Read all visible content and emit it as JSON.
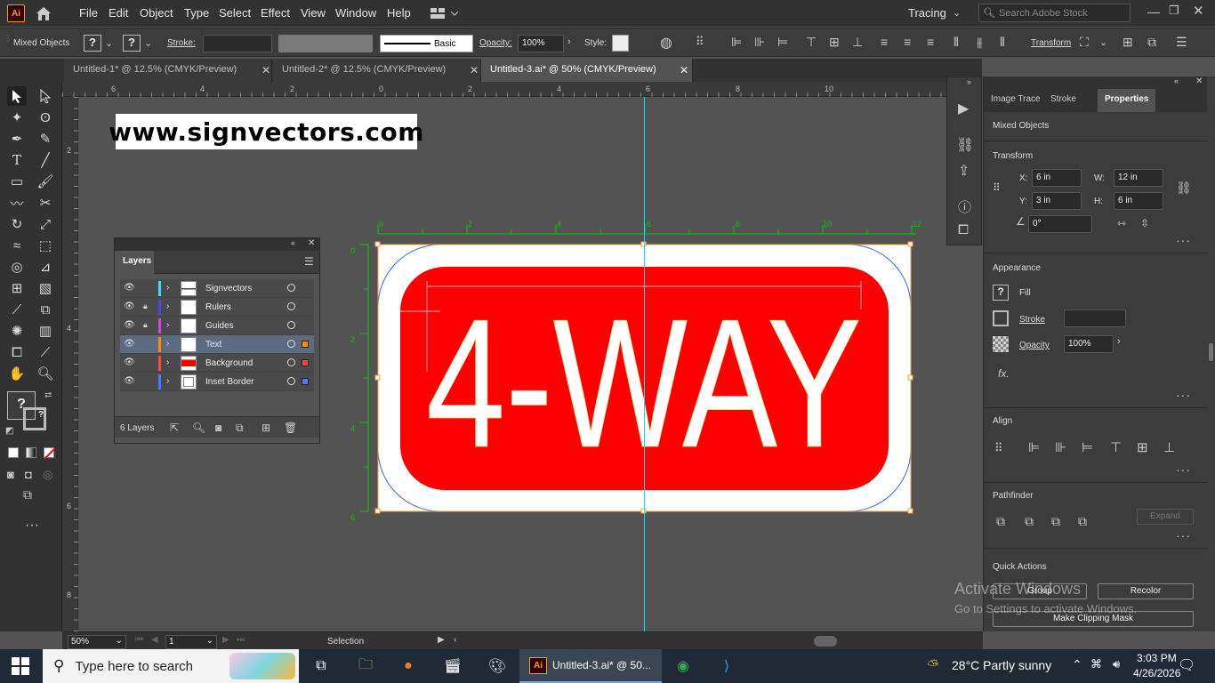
{
  "menubar": {
    "app_logo": "Ai",
    "items": [
      "File",
      "Edit",
      "Object",
      "Type",
      "Select",
      "Effect",
      "View",
      "Window",
      "Help"
    ],
    "workspace": "Tracing",
    "search_placeholder": "Search Adobe Stock"
  },
  "controlbar": {
    "selection_type": "Mixed Objects",
    "stroke_label": "Stroke:",
    "brush_style": "Basic",
    "opacity_label": "Opacity:",
    "opacity_value": "100%",
    "style_label": "Style:",
    "transform_label": "Transform"
  },
  "tabs": [
    {
      "label": "Untitled-1* @ 12.5% (CMYK/Preview)"
    },
    {
      "label": "Untitled-2* @ 12.5% (CMYK/Preview)"
    },
    {
      "label": "Untitled-3.ai* @ 50% (CMYK/Preview)",
      "active": true
    }
  ],
  "ruler_top": [
    "6",
    "4",
    "2",
    "0",
    "2",
    "4",
    "6",
    "8",
    "10"
  ],
  "ruler_left": [
    "2",
    "4",
    "6",
    "8"
  ],
  "artboard_ruler_top": [
    "0",
    "2",
    "4",
    "6",
    "8",
    "10",
    "12"
  ],
  "artboard_ruler_left": [
    "0",
    "2",
    "4",
    "6"
  ],
  "canvas": {
    "watermark": "www.signvectors.com",
    "sign_text": "4-WAY",
    "sign_color": "#ff0000",
    "border_color": "#ffffff"
  },
  "layers_panel": {
    "title": "Layers",
    "layers": [
      {
        "name": "Signvectors",
        "color": "#3fd9ff",
        "locked": false,
        "selected": false
      },
      {
        "name": "Rulers",
        "color": "#4a4ade",
        "locked": true,
        "selected": false
      },
      {
        "name": "Guides",
        "color": "#c84ade",
        "locked": true,
        "selected": false
      },
      {
        "name": "Text",
        "color": "#ff8c00",
        "locked": false,
        "selected": true
      },
      {
        "name": "Background",
        "color": "#ff4a4a",
        "locked": false,
        "selected": false
      },
      {
        "name": "Inset Border",
        "color": "#4a7aff",
        "locked": false,
        "selected": false
      }
    ],
    "count_label": "6 Layers"
  },
  "properties": {
    "tabs": [
      "Image Trace",
      "Stroke",
      "Properties"
    ],
    "selection": "Mixed Objects",
    "transform": {
      "title": "Transform",
      "x": "6 in",
      "y": "3 in",
      "w": "12 in",
      "h": "6 in",
      "angle": "0°",
      "x_label": "X:",
      "y_label": "Y:",
      "w_label": "W:",
      "h_label": "H:"
    },
    "appearance": {
      "title": "Appearance",
      "fill_label": "Fill",
      "stroke_label": "Stroke",
      "opacity_label": "Opacity",
      "opacity_value": "100%"
    },
    "align_title": "Align",
    "pathfinder": {
      "title": "Pathfinder",
      "expand_label": "Expand"
    },
    "quick_actions": {
      "title": "Quick Actions",
      "group_label": "Group",
      "recolor_label": "Recolor",
      "clipping_label": "Make Clipping Mask"
    }
  },
  "statusbar": {
    "zoom": "50%",
    "artboard": "1",
    "tool": "Selection"
  },
  "windows_watermark": {
    "line1": "Activate Windows",
    "line2": "Go to Settings to activate Windows."
  },
  "taskbar": {
    "search_placeholder": "Type here to search",
    "active_app": "Untitled-3.ai* @ 50...",
    "weather": "28°C  Partly sunny",
    "time": "3:03 PM",
    "date": "4/26/2026"
  }
}
